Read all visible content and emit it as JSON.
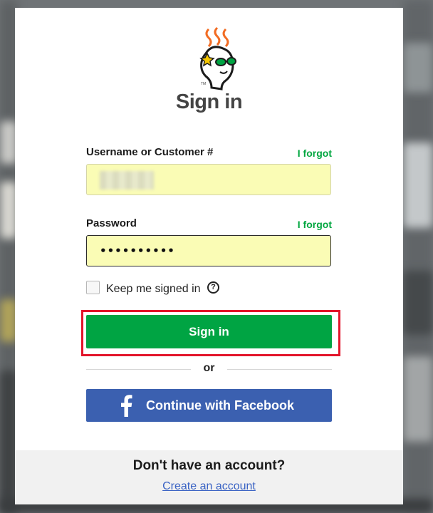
{
  "page": {
    "title": "Sign in"
  },
  "username": {
    "label": "Username or Customer #",
    "forgot": "I forgot",
    "value": ""
  },
  "password": {
    "label": "Password",
    "forgot": "I forgot",
    "masked_value": "••••••••••"
  },
  "keep_signed_in": {
    "label": "Keep me signed in",
    "checked": false,
    "help_icon": "question-circle-icon",
    "help_glyph": "?"
  },
  "buttons": {
    "signin": "Sign in",
    "or": "or",
    "facebook": "Continue with Facebook"
  },
  "footer": {
    "question": "Don't have an account?",
    "create_link": "Create an account"
  },
  "colors": {
    "accent_green": "#00a443",
    "facebook_blue": "#3b60b0",
    "highlight_red": "#e3152b",
    "input_fill": "#fafcb5"
  }
}
